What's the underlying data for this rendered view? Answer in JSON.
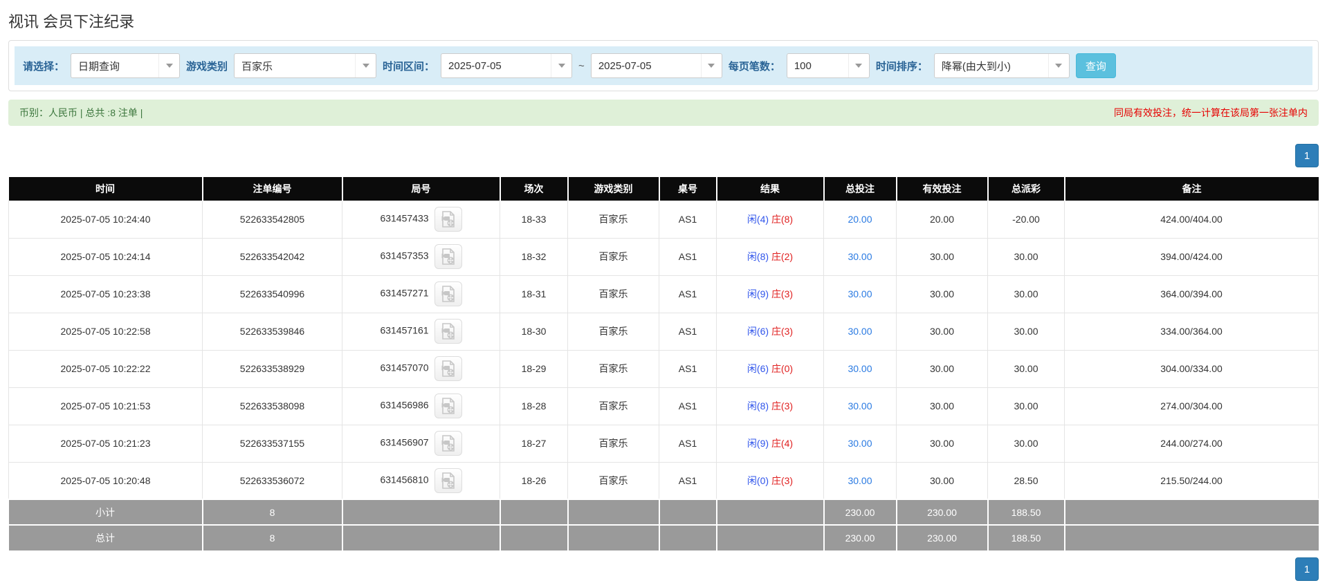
{
  "page_title": "视讯 会员下注纪录",
  "filters": {
    "select_label": "请选择：",
    "select_value": "日期查询",
    "game_type_label": "游戏类别",
    "game_type_value": "百家乐",
    "time_range_label": "时间区间：",
    "date_from": "2025-07-05",
    "range_separator": "~",
    "date_to": "2025-07-05",
    "page_size_label": "每页笔数：",
    "page_size_value": "100",
    "sort_label": "时间排序：",
    "sort_value": "降幂(由大到小)",
    "search_button_label": "查询"
  },
  "summary": {
    "currency_text": "币别：人民币 | 总共 :8 注单 |",
    "notice_text": "同局有效投注，统一计算在该局第一张注单内"
  },
  "pagination": {
    "current_page": "1"
  },
  "icons": {
    "dropdown_caret": "chevron-down-icon",
    "round_video": "video-file-icon"
  },
  "colors": {
    "player_blue": "#2f54eb",
    "banker_red": "#e02020",
    "link_blue": "#2a7ae2",
    "negative_red": "#e60000",
    "header_black": "#0b0b0b",
    "pagination_blue": "#2d7eb8",
    "filter_bg_blue": "#d9edf7",
    "summary_bg_green": "#dff0d8",
    "search_btn_cyan": "#5bc0de",
    "footer_gray": "#9a9a9a"
  },
  "table": {
    "headers": [
      "时间",
      "注单编号",
      "局号",
      "场次",
      "游戏类别",
      "桌号",
      "结果",
      "总投注",
      "有效投注",
      "总派彩",
      "备注"
    ],
    "rows": [
      {
        "time": "2025-07-05 10:24:40",
        "bet_id": "522633542805",
        "round_id": "631457433",
        "session": "18-33",
        "game": "百家乐",
        "table_no": "AS1",
        "result_player": "闲(4)",
        "result_banker": "庄(8)",
        "total_bet": "20.00",
        "valid_bet": "20.00",
        "payout": "-20.00",
        "remark": "424.00/404.00"
      },
      {
        "time": "2025-07-05 10:24:14",
        "bet_id": "522633542042",
        "round_id": "631457353",
        "session": "18-32",
        "game": "百家乐",
        "table_no": "AS1",
        "result_player": "闲(8)",
        "result_banker": "庄(2)",
        "total_bet": "30.00",
        "valid_bet": "30.00",
        "payout": "30.00",
        "remark": "394.00/424.00"
      },
      {
        "time": "2025-07-05 10:23:38",
        "bet_id": "522633540996",
        "round_id": "631457271",
        "session": "18-31",
        "game": "百家乐",
        "table_no": "AS1",
        "result_player": "闲(9)",
        "result_banker": "庄(3)",
        "total_bet": "30.00",
        "valid_bet": "30.00",
        "payout": "30.00",
        "remark": "364.00/394.00"
      },
      {
        "time": "2025-07-05 10:22:58",
        "bet_id": "522633539846",
        "round_id": "631457161",
        "session": "18-30",
        "game": "百家乐",
        "table_no": "AS1",
        "result_player": "闲(6)",
        "result_banker": "庄(3)",
        "total_bet": "30.00",
        "valid_bet": "30.00",
        "payout": "30.00",
        "remark": "334.00/364.00"
      },
      {
        "time": "2025-07-05 10:22:22",
        "bet_id": "522633538929",
        "round_id": "631457070",
        "session": "18-29",
        "game": "百家乐",
        "table_no": "AS1",
        "result_player": "闲(6)",
        "result_banker": "庄(0)",
        "total_bet": "30.00",
        "valid_bet": "30.00",
        "payout": "30.00",
        "remark": "304.00/334.00"
      },
      {
        "time": "2025-07-05 10:21:53",
        "bet_id": "522633538098",
        "round_id": "631456986",
        "session": "18-28",
        "game": "百家乐",
        "table_no": "AS1",
        "result_player": "闲(8)",
        "result_banker": "庄(3)",
        "total_bet": "30.00",
        "valid_bet": "30.00",
        "payout": "30.00",
        "remark": "274.00/304.00"
      },
      {
        "time": "2025-07-05 10:21:23",
        "bet_id": "522633537155",
        "round_id": "631456907",
        "session": "18-27",
        "game": "百家乐",
        "table_no": "AS1",
        "result_player": "闲(9)",
        "result_banker": "庄(4)",
        "total_bet": "30.00",
        "valid_bet": "30.00",
        "payout": "30.00",
        "remark": "244.00/274.00"
      },
      {
        "time": "2025-07-05 10:20:48",
        "bet_id": "522633536072",
        "round_id": "631456810",
        "session": "18-26",
        "game": "百家乐",
        "table_no": "AS1",
        "result_player": "闲(0)",
        "result_banker": "庄(3)",
        "total_bet": "30.00",
        "valid_bet": "30.00",
        "payout": "28.50",
        "remark": "215.50/244.00"
      }
    ],
    "subtotal": {
      "label": "小计",
      "count": "8",
      "total_bet": "230.00",
      "valid_bet": "230.00",
      "payout": "188.50"
    },
    "total": {
      "label": "总计",
      "count": "8",
      "total_bet": "230.00",
      "valid_bet": "230.00",
      "payout": "188.50"
    }
  }
}
